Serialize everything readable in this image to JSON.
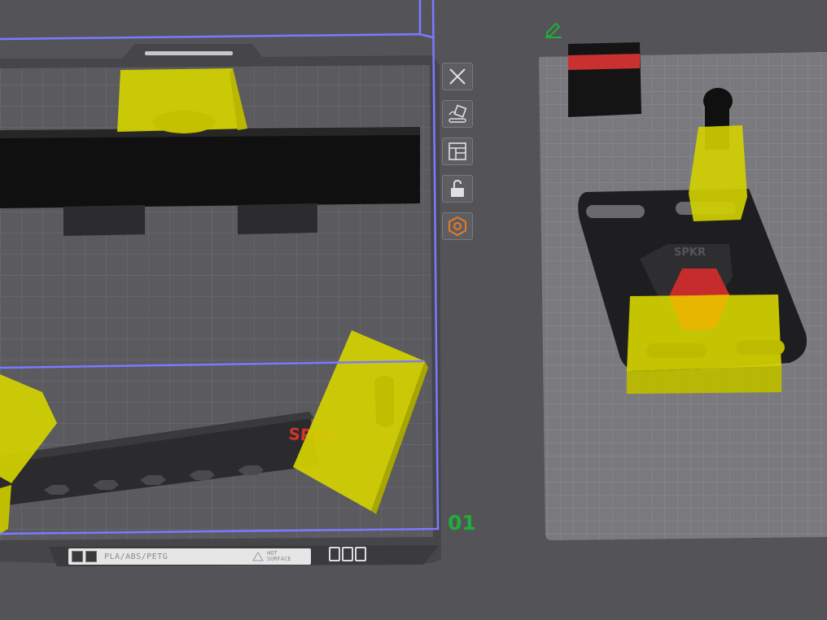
{
  "viewport": {
    "plate_number": "01",
    "plate_label": {
      "materials": "PLA/ABS/PETG",
      "hot_surface": "HOT SURFACE"
    },
    "model_text": "SPKR"
  },
  "plate_toolbar": {
    "buttons": [
      {
        "name": "close-plate-button",
        "icon": "close-icon"
      },
      {
        "name": "auto-orient-button",
        "icon": "auto-orient-icon"
      },
      {
        "name": "arrange-button",
        "icon": "arrange-icon"
      },
      {
        "name": "lock-plate-button",
        "icon": "unlock-icon"
      },
      {
        "name": "plate-settings-button",
        "icon": "hexagon-settings-icon"
      }
    ]
  },
  "colors": {
    "background": "#545458",
    "plate_grid": "#9a9aa0",
    "selection_yellow": "#d8d800",
    "bounding_box": "#7a7aff",
    "plate_number_green": "#1fae3a",
    "edit_icon_green": "#1fae3a",
    "settings_orange": "#e87a22"
  }
}
